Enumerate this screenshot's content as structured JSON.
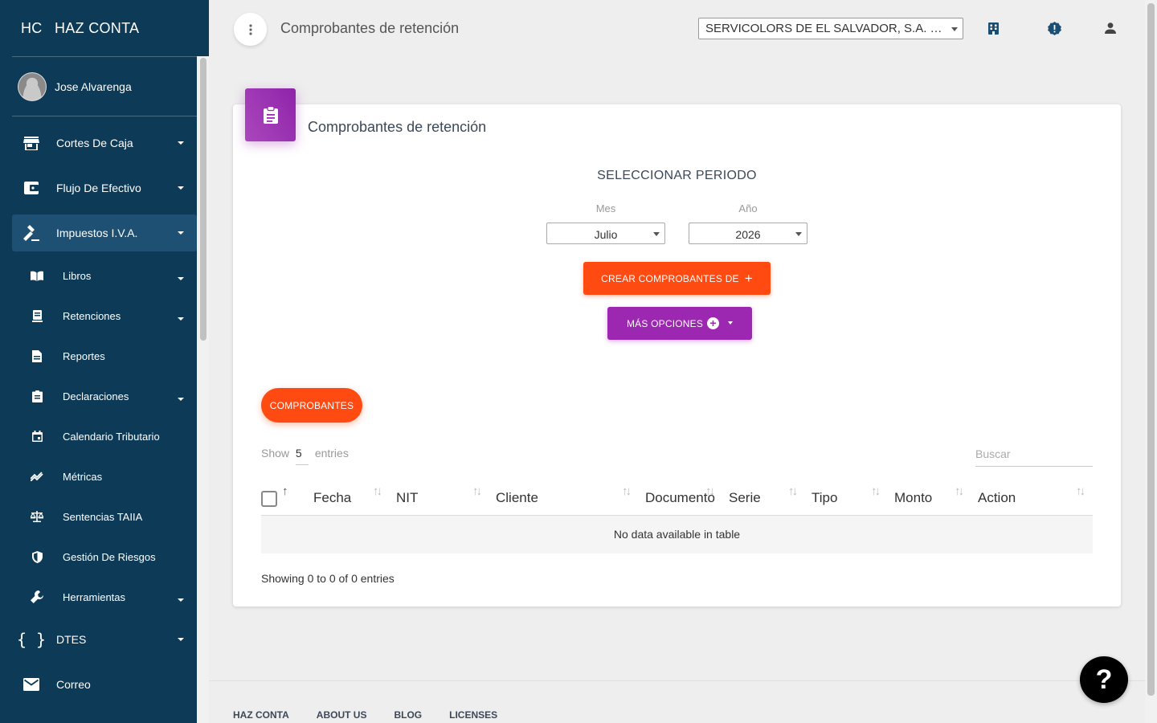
{
  "app": {
    "mini": "HC",
    "name": "HAZ CONTA"
  },
  "user": {
    "name": "Jose Alvarenga"
  },
  "sidebar": {
    "items": [
      {
        "label": "Cortes De Caja",
        "icon": "store-icon"
      },
      {
        "label": "Flujo De Efectivo",
        "icon": "wallet-icon"
      },
      {
        "label": "Impuestos I.V.A.",
        "icon": "gavel-icon"
      }
    ],
    "sub": [
      {
        "label": "Libros",
        "icon": "book-icon"
      },
      {
        "label": "Retenciones",
        "icon": "receipt-icon"
      },
      {
        "label": "Reportes",
        "icon": "document-icon"
      },
      {
        "label": "Declaraciones",
        "icon": "clipboard-icon"
      },
      {
        "label": "Calendario Tributario",
        "icon": "calendar-icon"
      },
      {
        "label": "Métricas",
        "icon": "trend-icon"
      },
      {
        "label": "Sentencias TAIIA",
        "icon": "balance-icon"
      },
      {
        "label": "Gestión De Riesgos",
        "icon": "shield-icon"
      },
      {
        "label": "Herramientas",
        "icon": "wrench-icon"
      }
    ],
    "bottom": [
      {
        "label": "DTES",
        "icon": "braces-icon"
      },
      {
        "label": "Correo",
        "icon": "mail-icon"
      }
    ]
  },
  "header": {
    "title": "Comprobantes de retención",
    "company": "SERVICOLORS DE EL SALVADOR, S.A. DE C.V."
  },
  "card": {
    "title": "Comprobantes de retención",
    "periodo": "SELECCIONAR PERIODO",
    "mes_label": "Mes",
    "mes_value": "Julio",
    "anio_label": "Año",
    "anio_value": "2026",
    "crear_label": "CREAR COMPROBANTES DE",
    "mas_label": "MÁS OPCIONES",
    "comprobantes_label": "COMPROBANTES"
  },
  "table": {
    "show": "Show",
    "length": "5",
    "entries": "entries",
    "search_placeholder": "Buscar",
    "columns": [
      "Fecha",
      "NIT",
      "Cliente",
      "Documento",
      "Serie",
      "Tipo",
      "Monto",
      "Action"
    ],
    "empty": "No data available in table",
    "info": "Showing 0 to 0 of 0 entries"
  },
  "footer": {
    "links": [
      "HAZ CONTA",
      "ABOUT US",
      "BLOG",
      "LICENSES"
    ]
  },
  "help": {
    "label": "?"
  },
  "colors": {
    "sidebar": "#0d3a57",
    "orange": "#ff4a12",
    "purple": "#9c27b0"
  }
}
